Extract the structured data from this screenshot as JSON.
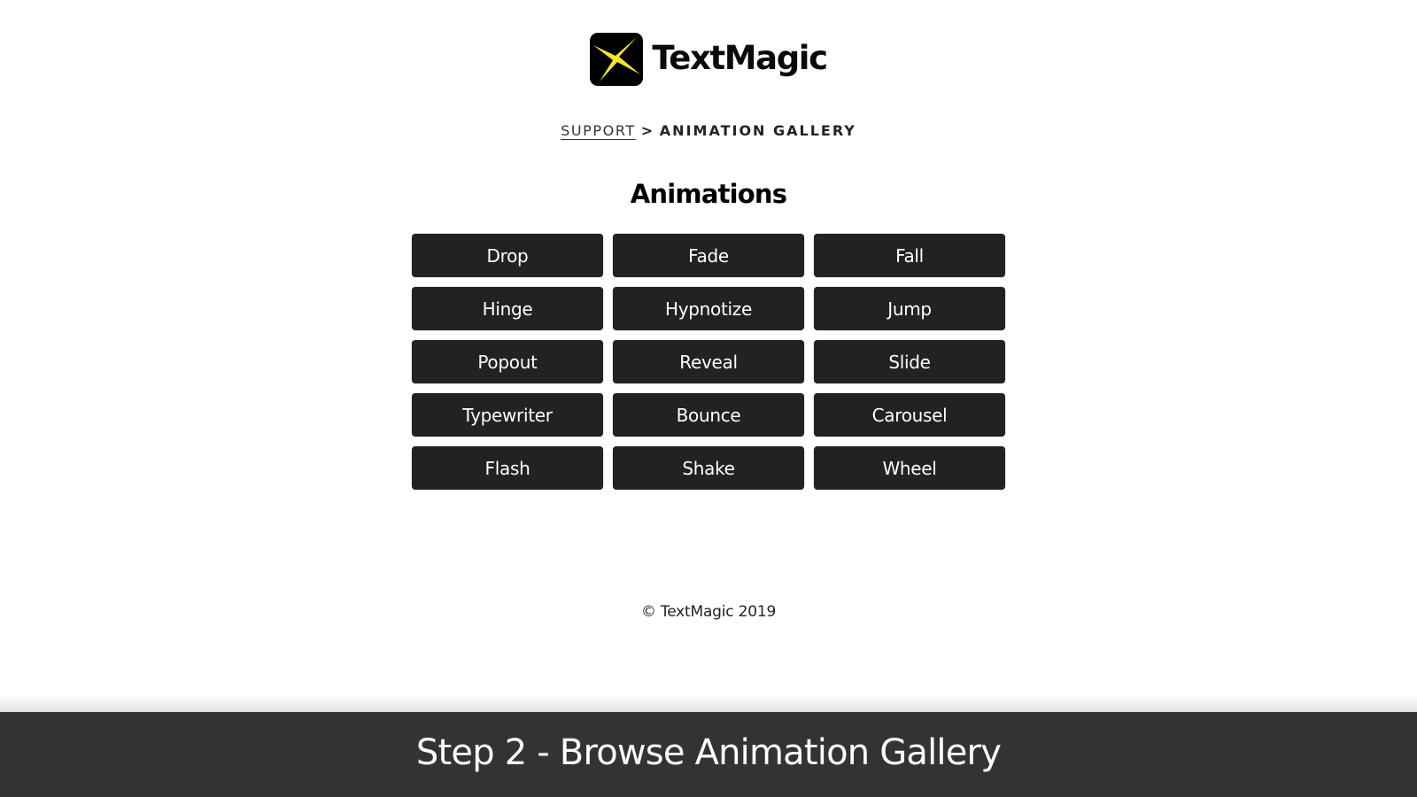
{
  "brand": {
    "name": "TextMagic",
    "icon": "sparkle-star-icon",
    "icon_colors": {
      "background": "#000000",
      "star": "#f5e52a"
    }
  },
  "breadcrumb": {
    "link_label": "SUPPORT",
    "separator": ">",
    "current_label": "ANIMATION GALLERY"
  },
  "section": {
    "title": "Animations"
  },
  "animations": [
    "Drop",
    "Fade",
    "Fall",
    "Hinge",
    "Hypnotize",
    "Jump",
    "Popout",
    "Reveal",
    "Slide",
    "Typewriter",
    "Bounce",
    "Carousel",
    "Flash",
    "Shake",
    "Wheel"
  ],
  "footer": {
    "copyright": "© TextMagic 2019"
  },
  "caption": {
    "text": "Step 2 - Browse Animation Gallery"
  },
  "colors": {
    "button_bg": "#222222",
    "button_text": "#ffffff",
    "caption_bg": "#333333"
  }
}
